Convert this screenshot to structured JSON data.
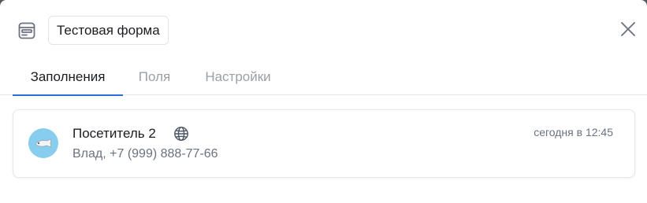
{
  "header": {
    "title": "Тестовая форма",
    "icon": "form-icon",
    "close_icon": "close-icon"
  },
  "tabs": [
    {
      "label": "Заполнения",
      "active": true
    },
    {
      "label": "Поля",
      "active": false
    },
    {
      "label": "Настройки",
      "active": false
    }
  ],
  "submissions": [
    {
      "visitor": "Посетитель 2",
      "source_icon": "globe-icon",
      "contact": "Влад, +7 (999) 888-77-66",
      "time": "сегодня в 12:45",
      "avatar_color": "#87ceee"
    }
  ],
  "colors": {
    "accent": "#2b6fd6",
    "text": "#1b1d21",
    "muted": "#9aa0a6"
  }
}
